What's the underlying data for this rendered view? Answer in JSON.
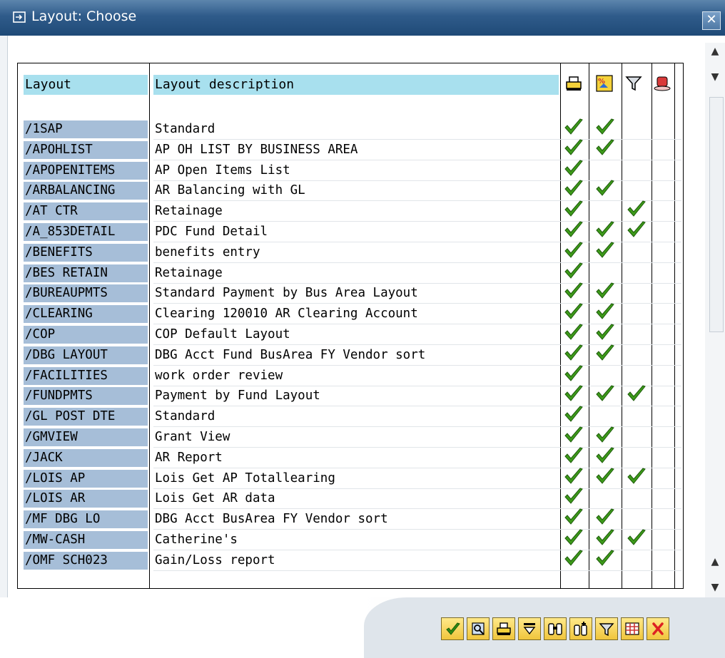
{
  "window": {
    "title": "Layout: Choose",
    "close_label": "✕"
  },
  "table": {
    "headers": {
      "layout": "Layout",
      "description": "Layout description"
    },
    "header_icons": [
      "print-icon",
      "user-specific-icon",
      "filter-icon",
      "default-setting-icon"
    ],
    "rows": [
      {
        "code": "/1SAP",
        "desc": "Standard",
        "c": [
          1,
          1,
          0,
          0
        ]
      },
      {
        "code": "/APOHLIST",
        "desc": "AP OH LIST BY BUSINESS AREA",
        "c": [
          1,
          1,
          0,
          0
        ]
      },
      {
        "code": "/APOPENITEMS",
        "desc": "AP Open Items List",
        "c": [
          1,
          0,
          0,
          0
        ]
      },
      {
        "code": "/ARBALANCING",
        "desc": "AR Balancing with GL",
        "c": [
          1,
          1,
          0,
          0
        ]
      },
      {
        "code": "/AT CTR",
        "desc": "Retainage",
        "c": [
          1,
          0,
          1,
          0
        ]
      },
      {
        "code": "/A_853DETAIL",
        "desc": "PDC Fund Detail",
        "c": [
          1,
          1,
          1,
          0
        ]
      },
      {
        "code": "/BENEFITS",
        "desc": "benefits entry",
        "c": [
          1,
          1,
          0,
          0
        ]
      },
      {
        "code": "/BES RETAIN",
        "desc": "Retainage",
        "c": [
          1,
          0,
          0,
          0
        ]
      },
      {
        "code": "/BUREAUPMTS",
        "desc": "Standard Payment by Bus Area Layout",
        "c": [
          1,
          1,
          0,
          0
        ]
      },
      {
        "code": "/CLEARING",
        "desc": "Clearing 120010 AR Clearing Account",
        "c": [
          1,
          1,
          0,
          0
        ]
      },
      {
        "code": "/COP",
        "desc": "COP Default Layout",
        "c": [
          1,
          1,
          0,
          0
        ]
      },
      {
        "code": "/DBG LAYOUT",
        "desc": "DBG Acct Fund BusArea FY Vendor sort",
        "c": [
          1,
          1,
          0,
          0
        ]
      },
      {
        "code": "/FACILITIES",
        "desc": "work order review",
        "c": [
          1,
          0,
          0,
          0
        ]
      },
      {
        "code": "/FUNDPMTS",
        "desc": "Payment by Fund Layout",
        "c": [
          1,
          1,
          1,
          0
        ]
      },
      {
        "code": "/GL POST DTE",
        "desc": "Standard",
        "c": [
          1,
          0,
          0,
          0
        ]
      },
      {
        "code": "/GMVIEW",
        "desc": "Grant View",
        "c": [
          1,
          1,
          0,
          0
        ]
      },
      {
        "code": "/JACK",
        "desc": "AR Report",
        "c": [
          1,
          1,
          0,
          0
        ]
      },
      {
        "code": "/LOIS AP",
        "desc": "Lois Get AP Totallearing",
        "c": [
          1,
          1,
          1,
          0
        ]
      },
      {
        "code": "/LOIS AR",
        "desc": "Lois Get AR data",
        "c": [
          1,
          0,
          0,
          0
        ]
      },
      {
        "code": "/MF DBG LO",
        "desc": "DBG Acct BusArea FY Vendor sort",
        "c": [
          1,
          1,
          0,
          0
        ]
      },
      {
        "code": "/MW-CASH",
        "desc": "Catherine's",
        "c": [
          1,
          1,
          1,
          0
        ]
      },
      {
        "code": "/OMF SCH023",
        "desc": "Gain/Loss report",
        "c": [
          1,
          1,
          0,
          0
        ]
      }
    ]
  },
  "toolbar": {
    "buttons": [
      "checkmark-icon",
      "details-icon",
      "print-icon",
      "sort-icon",
      "find-icon",
      "find-next-icon",
      "filter-icon",
      "grid-icon",
      "cancel-icon"
    ]
  },
  "colors": {
    "title_bar": "#2f5b8a",
    "header": "#a8e0ee",
    "code_cell": "#a6bed8",
    "check": "#3d9a1a"
  }
}
